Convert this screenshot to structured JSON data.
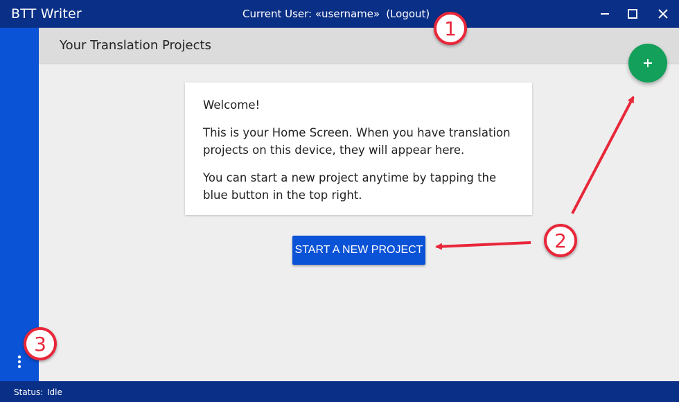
{
  "titlebar": {
    "app_title": "BTT Writer",
    "current_user_label": "Current User: «username»",
    "logout_label": "(Logout)"
  },
  "header": {
    "title": "Your Translation Projects"
  },
  "card": {
    "welcome": "Welcome!",
    "paragraph_1": "This is your Home Screen. When you have translation projects on this device, they will appear here.",
    "paragraph_2": "You can start a new project anytime by tapping the blue button in the top right."
  },
  "start_button": {
    "label": "START A NEW PROJECT"
  },
  "fab": {
    "icon": "plus-icon"
  },
  "statusbar": {
    "label": "Status:",
    "value": "Idle"
  },
  "annotations": {
    "callout_1": "1",
    "callout_2": "2",
    "callout_3": "3"
  },
  "colors": {
    "titlebar": "#0a2f86",
    "sidebar": "#0a52d6",
    "primary_button": "#0a52d6",
    "fab": "#12a05a",
    "annotation_red": "#e8273a"
  }
}
